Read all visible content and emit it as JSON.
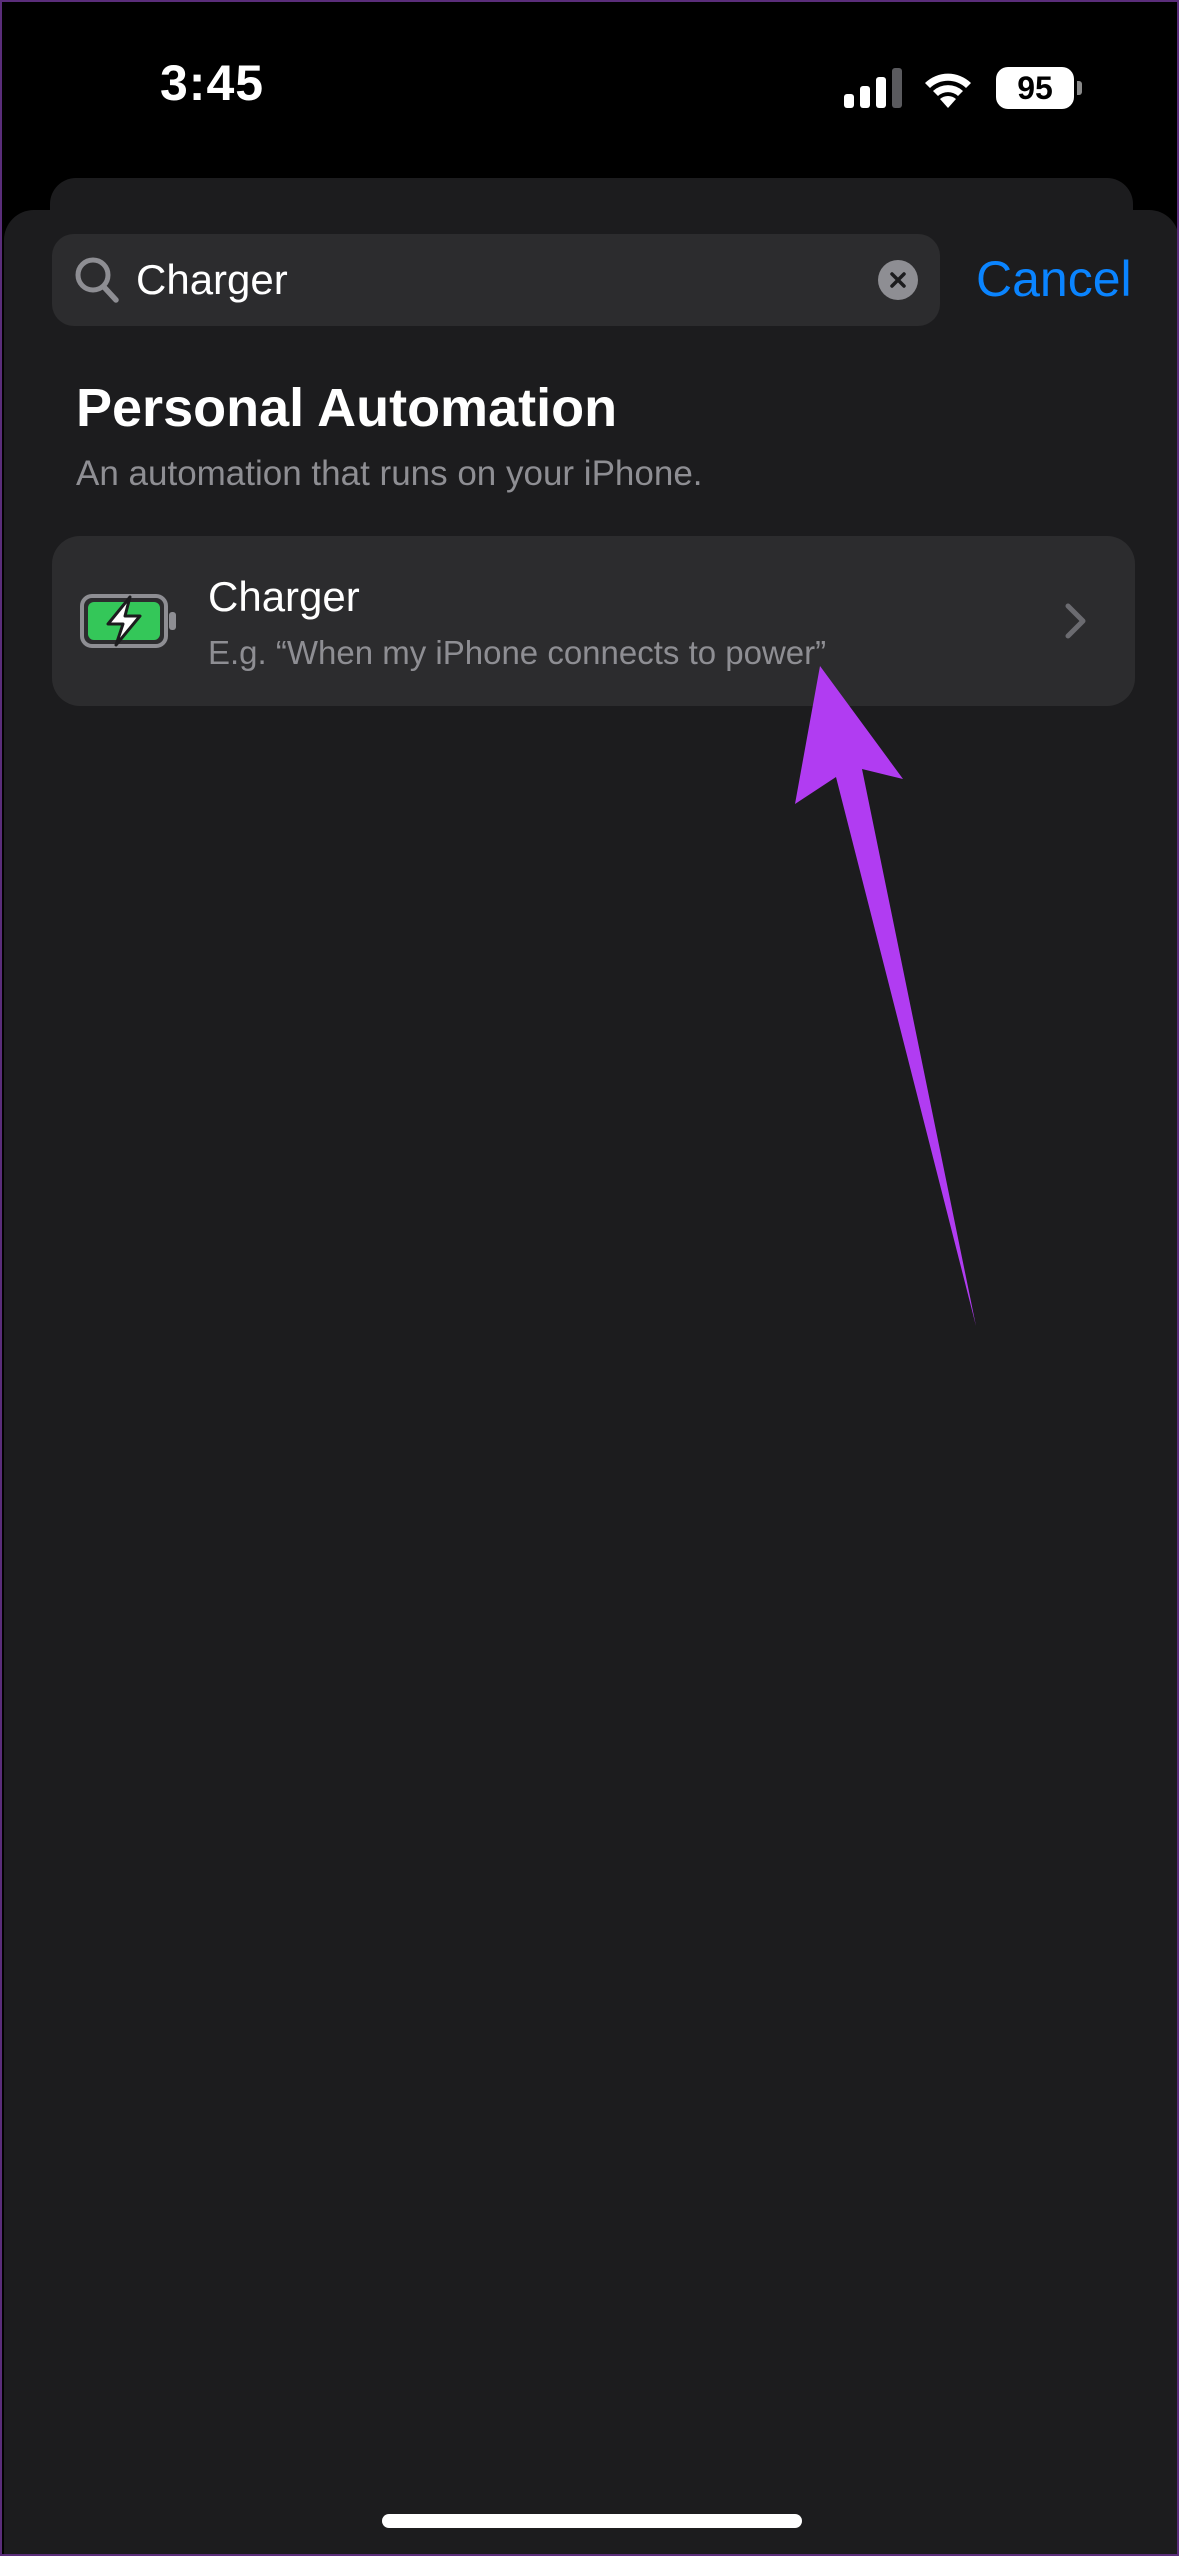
{
  "status_bar": {
    "time": "3:45",
    "battery_level": "95",
    "signal_icon": "cellular-signal-icon",
    "wifi_icon": "wifi-icon"
  },
  "search": {
    "value": "Charger",
    "cancel_label": "Cancel",
    "icon": "search-icon",
    "clear_icon": "clear-icon"
  },
  "section": {
    "title": "Personal Automation",
    "subtitle": "An automation that runs on your iPhone."
  },
  "results": [
    {
      "title": "Charger",
      "subtitle": "E.g. “When my iPhone connects to power”",
      "icon": "battery-charging-icon"
    }
  ],
  "colors": {
    "accent": "#0a84ff",
    "background": "#1c1c1e",
    "row_background": "#2c2c2e",
    "secondary_text": "#8e8e93",
    "battery_green": "#34c759",
    "annotation_arrow": "#b13cf2"
  }
}
